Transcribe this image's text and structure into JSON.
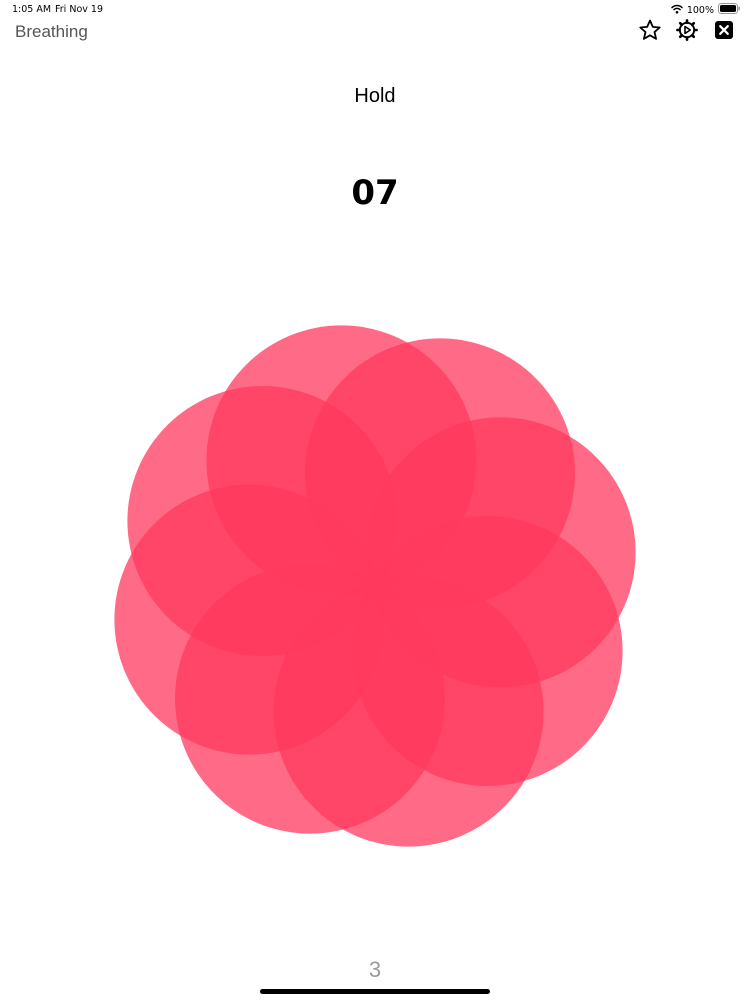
{
  "status_bar": {
    "time": "1:05 AM",
    "date": "Fri Nov 19",
    "battery_percent": "100%",
    "icons": [
      "wifi-icon",
      "battery-icon"
    ]
  },
  "nav": {
    "title": "Breathing",
    "actions": [
      {
        "name": "favorite",
        "icon": "star-outline-icon"
      },
      {
        "name": "settings",
        "icon": "gear-icon"
      },
      {
        "name": "close",
        "icon": "close-icon"
      }
    ]
  },
  "session": {
    "phase": "Hold",
    "countdown": "07",
    "cycles": "3"
  },
  "flower": {
    "petal_count": 8,
    "petal_color": "#FF3A5E",
    "petal_opacity": 0.75
  }
}
